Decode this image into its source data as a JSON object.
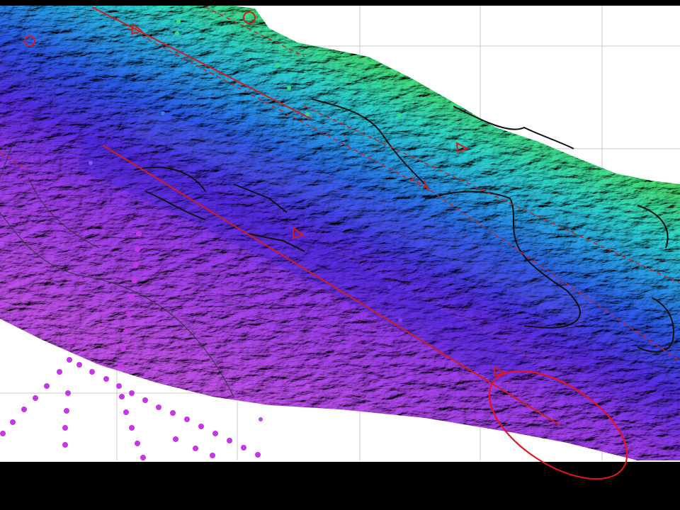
{
  "map": {
    "kind": "shaded-relief multibeam bathymetry swath",
    "color_ramp": [
      "#c84cf0",
      "#8a3af0",
      "#4a2ce8",
      "#1f7ff0",
      "#22c8e8",
      "#3ee68a",
      "#6ae84a"
    ],
    "background": "#ffffff",
    "frame_color": "#000000",
    "grid_color": "#c8c8c8",
    "fault_color": "#cc1f1f",
    "contour_color": "#111111",
    "marker_color": "#c437e6",
    "highlight_color": "#e8141c"
  }
}
